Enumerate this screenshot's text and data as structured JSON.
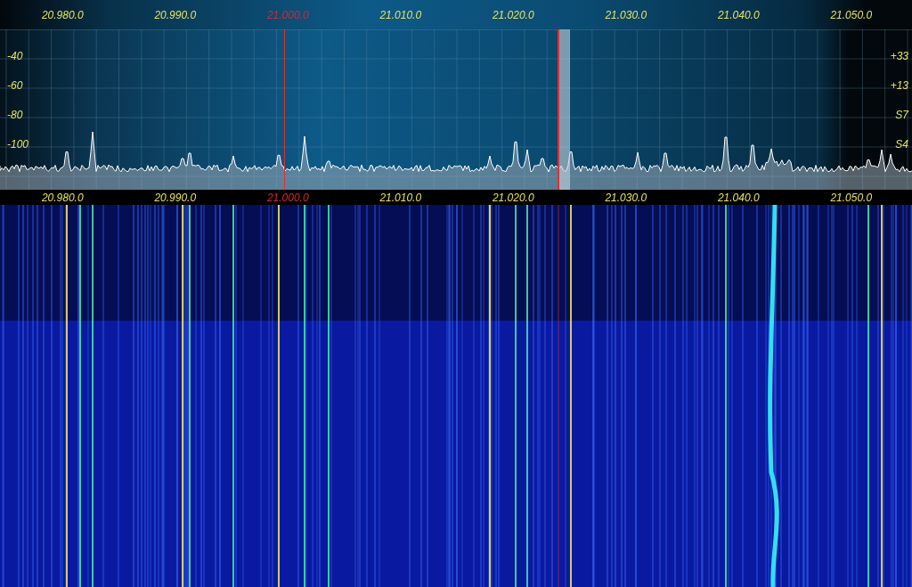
{
  "top_scale": [
    {
      "label": "20.980.0",
      "highlighted": false
    },
    {
      "label": "20.990.0",
      "highlighted": false
    },
    {
      "label": "21.000.0",
      "highlighted": true
    },
    {
      "label": "21.010.0",
      "highlighted": false
    },
    {
      "label": "21.020.0",
      "highlighted": false
    },
    {
      "label": "21.030.0",
      "highlighted": false
    },
    {
      "label": "21.040.0",
      "highlighted": false
    },
    {
      "label": "21.050.0",
      "highlighted": false
    }
  ],
  "db_labels": [
    "-40",
    "-60",
    "-80",
    "-100"
  ],
  "s_labels": [
    "+33",
    "+13",
    "S7",
    "S4"
  ],
  "bottom_scale": [
    {
      "label": "20.980.0",
      "highlighted": false
    },
    {
      "label": "20.990.0",
      "highlighted": false
    },
    {
      "label": "21.000.0",
      "highlighted": true
    },
    {
      "label": "21.010.0",
      "highlighted": false
    },
    {
      "label": "21.020.0",
      "highlighted": false
    },
    {
      "label": "21.030.0",
      "highlighted": false
    },
    {
      "label": "21.040.0",
      "highlighted": false
    },
    {
      "label": "21.050.0",
      "highlighted": false
    }
  ]
}
